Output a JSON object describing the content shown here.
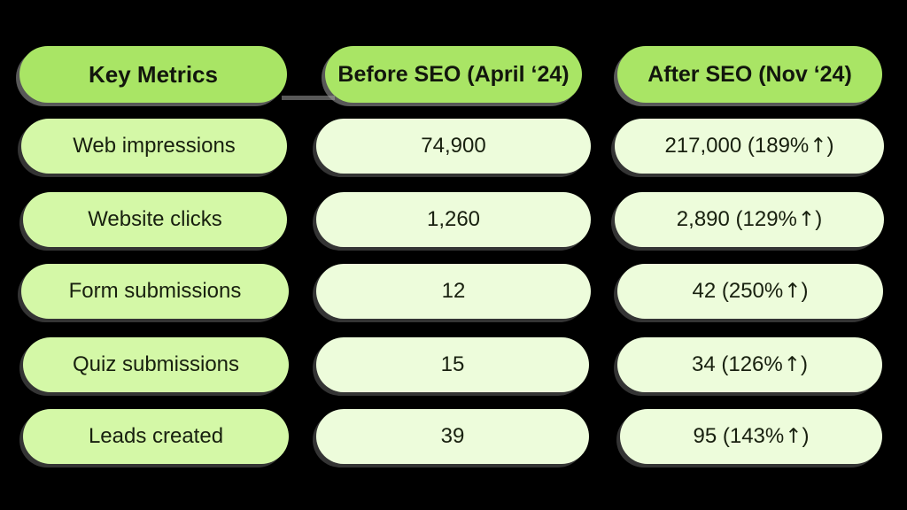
{
  "table": {
    "columns": [
      {
        "key": "metric",
        "header": "Key Metrics"
      },
      {
        "key": "before",
        "header": "Before SEO (April ‘24)"
      },
      {
        "key": "after",
        "header": "After SEO (Nov ‘24)"
      }
    ],
    "rows": [
      {
        "metric": "Web impressions",
        "before": "74,900",
        "after_value": "217,000 (189% ",
        "after_arrow": "↑",
        "after_close": " )",
        "after": "217,000 (189% ↑ )"
      },
      {
        "metric": "Website clicks",
        "before": "1,260",
        "after_value": "2,890 (129% ",
        "after_arrow": "↑",
        "after_close": " )",
        "after": "2,890 (129% ↑ )"
      },
      {
        "metric": "Form submissions",
        "before": "12",
        "after_value": "42 (250% ",
        "after_arrow": "↑",
        "after_close": " )",
        "after": "42 (250% ↑ )"
      },
      {
        "metric": "Quiz submissions",
        "before": "15",
        "after_value": "34 (126% ",
        "after_arrow": "↑",
        "after_close": " )",
        "after": "34 (126% ↑ )"
      },
      {
        "metric": "Leads created",
        "before": "39",
        "after_value": "95 (143% ",
        "after_arrow": "↑",
        "after_close": " )",
        "after": "95 (143% ↑ )"
      }
    ]
  },
  "colors": {
    "background": "#000000",
    "header_green": "#a9e565",
    "left_cell_green": "#d4f8a7",
    "value_cell_green": "#edfcdb",
    "shadow_grey": "#a0a0a0",
    "text": "#161616"
  }
}
